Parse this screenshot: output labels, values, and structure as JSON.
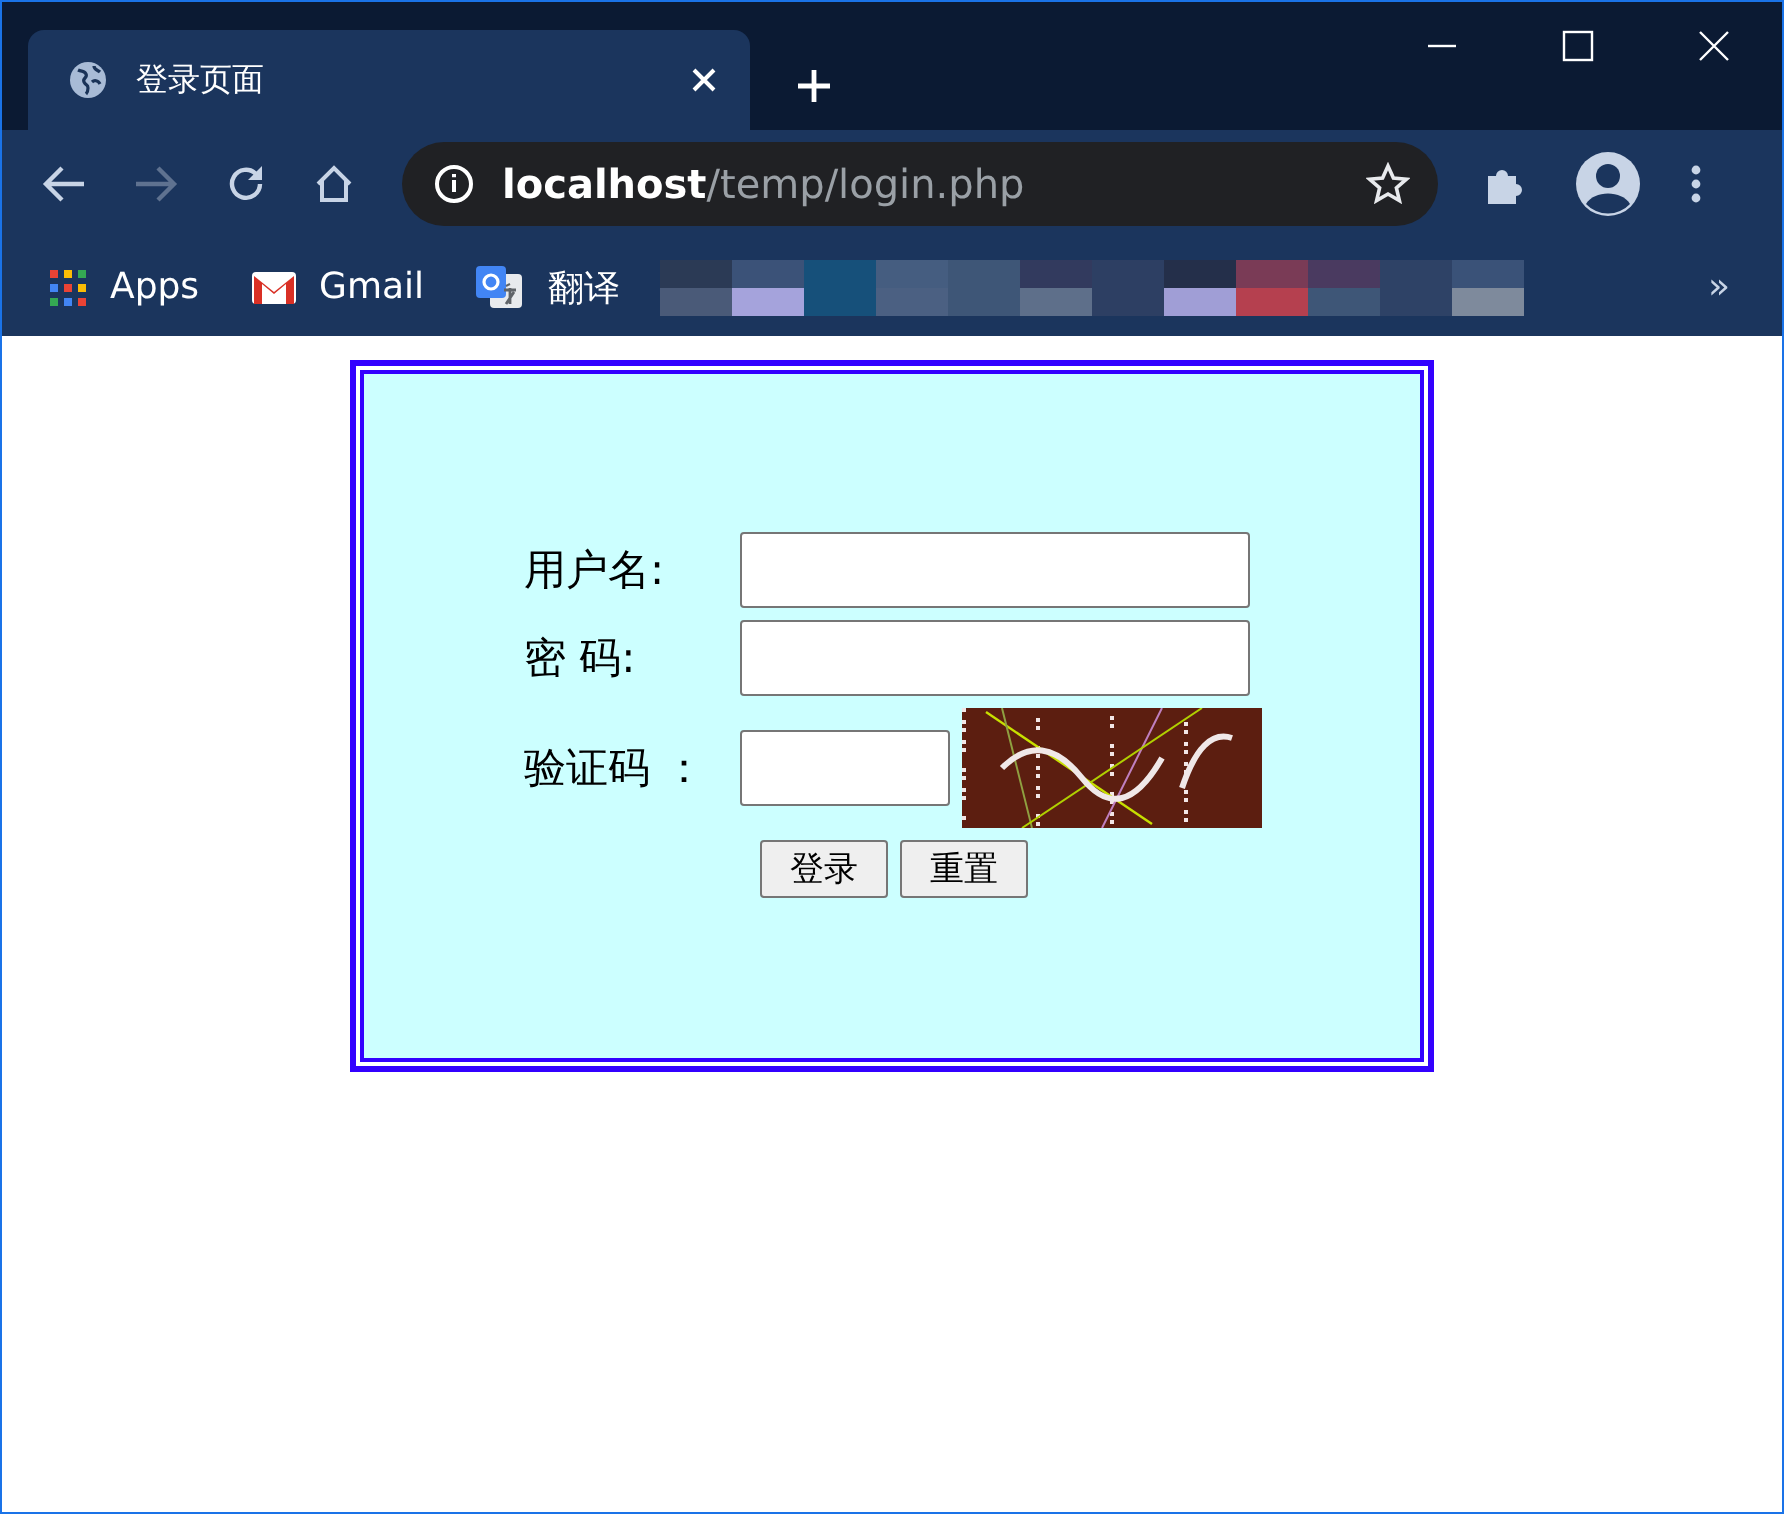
{
  "tabs": [
    {
      "title": "登录页面",
      "selected": true
    }
  ],
  "navigation": {
    "back_enabled": true,
    "forward_enabled": false
  },
  "address_bar": {
    "host": "localhost",
    "path": "/temp/login.php"
  },
  "bookmarks": [
    {
      "label": "Apps",
      "kind": "apps"
    },
    {
      "label": "Gmail",
      "kind": "gmail"
    },
    {
      "label": "翻译",
      "kind": "translate"
    }
  ],
  "bookmarks_overflow": "»",
  "form": {
    "fields": [
      {
        "label": "用户名:",
        "kind": "text"
      },
      {
        "label": "密 码:",
        "kind": "password"
      },
      {
        "label": "验证码 ：",
        "kind": "captcha"
      }
    ],
    "captcha": {
      "kind": "picture"
    },
    "buttons": [
      "登录",
      "重置"
    ]
  }
}
